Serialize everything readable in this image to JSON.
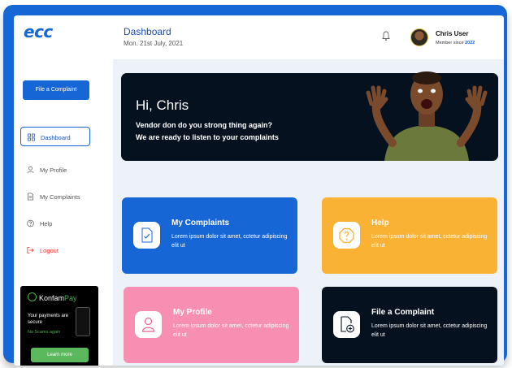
{
  "app": {
    "logo": "ecc"
  },
  "header": {
    "title": "Dashboard",
    "date": "Mon. 21st July, 2021",
    "user_name": "Chris User",
    "member_since_label": "Member since",
    "member_since_year": "2022"
  },
  "sidebar": {
    "file_button": "File a Complaint",
    "items": [
      {
        "label": "Dashboard",
        "icon": "grid-icon"
      },
      {
        "label": "My Profile",
        "icon": "user-icon"
      },
      {
        "label": "My Complaints",
        "icon": "document-icon"
      },
      {
        "label": "Help",
        "icon": "help-circle-icon"
      },
      {
        "label": "Logout",
        "icon": "logout-icon"
      }
    ],
    "promo": {
      "brand_prefix": "Konfam",
      "brand_suffix": "Pay",
      "text": "Your payments are secure",
      "subtext": "No Scams again",
      "button": "Learn more"
    }
  },
  "hero": {
    "title": "Hi, Chris",
    "line1": "Vendor don do you strong thing again?",
    "line2": "We are ready to listen to your complaints"
  },
  "cards": [
    {
      "title": "My Complaints",
      "body": "Lorem ipsum dolor sit amet, cctetur adipiscing elit ut"
    },
    {
      "title": "Help",
      "body": "Lorem ipsum dolor sit amet, cctetur adipiscing elit ut"
    },
    {
      "title": "My Profile",
      "body": "Lorem ipsum dolor sit amet, cctetur adipiscing elit ut"
    },
    {
      "title": "File a Complaint",
      "body": "Lorem ipsum dolor sit amet, cctetur adipiscing elit ut"
    }
  ],
  "colors": {
    "primary": "#1766d6",
    "dark": "#06111f",
    "yellow": "#f9b233",
    "pink": "#f78fb3",
    "danger": "#e53935",
    "green": "#5cb85c"
  }
}
